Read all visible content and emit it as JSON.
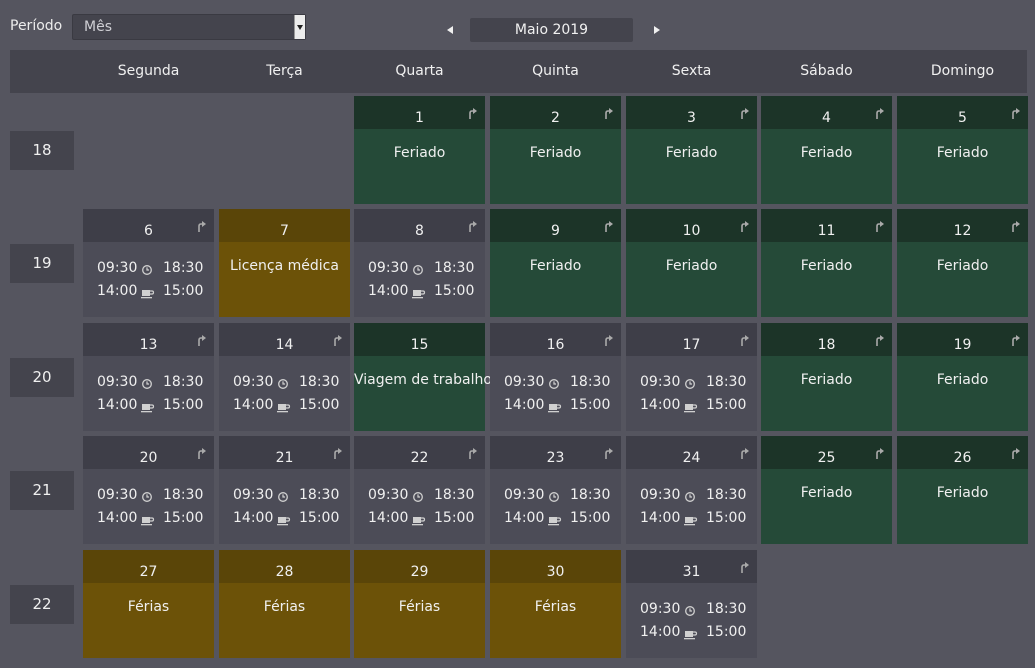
{
  "header": {
    "period_label": "Período",
    "period_value": "Mês",
    "month_title": "Maio 2019"
  },
  "weekdays": [
    "Segunda",
    "Terça",
    "Quarta",
    "Quinta",
    "Sexta",
    "Sábado",
    "Domingo"
  ],
  "weeks": [
    {
      "label": "18",
      "days": [
        null,
        null,
        {
          "day": "1",
          "type": "hol",
          "label": "Feriado",
          "arrow": true
        },
        {
          "day": "2",
          "type": "hol",
          "label": "Feriado",
          "arrow": true
        },
        {
          "day": "3",
          "type": "hol",
          "label": "Feriado",
          "arrow": true
        },
        {
          "day": "4",
          "type": "hol",
          "label": "Feriado",
          "arrow": true
        },
        {
          "day": "5",
          "type": "hol",
          "label": "Feriado",
          "arrow": true
        }
      ]
    },
    {
      "label": "19",
      "days": [
        {
          "day": "6",
          "type": "work",
          "arrow": true,
          "start": "09:30",
          "end": "18:30",
          "break_start": "14:00",
          "break_end": "15:00"
        },
        {
          "day": "7",
          "type": "leave",
          "label": "Licença médica",
          "arrow": false
        },
        {
          "day": "8",
          "type": "work",
          "arrow": true,
          "start": "09:30",
          "end": "18:30",
          "break_start": "14:00",
          "break_end": "15:00"
        },
        {
          "day": "9",
          "type": "hol",
          "label": "Feriado",
          "arrow": true
        },
        {
          "day": "10",
          "type": "hol",
          "label": "Feriado",
          "arrow": true
        },
        {
          "day": "11",
          "type": "hol",
          "label": "Feriado",
          "arrow": true
        },
        {
          "day": "12",
          "type": "hol",
          "label": "Feriado",
          "arrow": true
        }
      ]
    },
    {
      "label": "20",
      "days": [
        {
          "day": "13",
          "type": "work",
          "arrow": true,
          "start": "09:30",
          "end": "18:30",
          "break_start": "14:00",
          "break_end": "15:00"
        },
        {
          "day": "14",
          "type": "work",
          "arrow": true,
          "start": "09:30",
          "end": "18:30",
          "break_start": "14:00",
          "break_end": "15:00"
        },
        {
          "day": "15",
          "type": "trip",
          "label": "Viagem de trabalho",
          "arrow": false
        },
        {
          "day": "16",
          "type": "work",
          "arrow": true,
          "start": "09:30",
          "end": "18:30",
          "break_start": "14:00",
          "break_end": "15:00"
        },
        {
          "day": "17",
          "type": "work",
          "arrow": true,
          "start": "09:30",
          "end": "18:30",
          "break_start": "14:00",
          "break_end": "15:00"
        },
        {
          "day": "18",
          "type": "hol",
          "label": "Feriado",
          "arrow": true
        },
        {
          "day": "19",
          "type": "hol",
          "label": "Feriado",
          "arrow": true
        }
      ]
    },
    {
      "label": "21",
      "days": [
        {
          "day": "20",
          "type": "work",
          "arrow": true,
          "start": "09:30",
          "end": "18:30",
          "break_start": "14:00",
          "break_end": "15:00"
        },
        {
          "day": "21",
          "type": "work",
          "arrow": true,
          "start": "09:30",
          "end": "18:30",
          "break_start": "14:00",
          "break_end": "15:00"
        },
        {
          "day": "22",
          "type": "work",
          "arrow": true,
          "start": "09:30",
          "end": "18:30",
          "break_start": "14:00",
          "break_end": "15:00"
        },
        {
          "day": "23",
          "type": "work",
          "arrow": true,
          "start": "09:30",
          "end": "18:30",
          "break_start": "14:00",
          "break_end": "15:00"
        },
        {
          "day": "24",
          "type": "work",
          "arrow": true,
          "start": "09:30",
          "end": "18:30",
          "break_start": "14:00",
          "break_end": "15:00"
        },
        {
          "day": "25",
          "type": "hol",
          "label": "Feriado",
          "arrow": true
        },
        {
          "day": "26",
          "type": "hol",
          "label": "Feriado",
          "arrow": true
        }
      ]
    },
    {
      "label": "22",
      "days": [
        {
          "day": "27",
          "type": "leave",
          "label": "Férias",
          "arrow": false
        },
        {
          "day": "28",
          "type": "leave",
          "label": "Férias",
          "arrow": false
        },
        {
          "day": "29",
          "type": "leave",
          "label": "Férias",
          "arrow": false
        },
        {
          "day": "30",
          "type": "leave",
          "label": "Férias",
          "arrow": false
        },
        {
          "day": "31",
          "type": "work",
          "arrow": true,
          "start": "09:30",
          "end": "18:30",
          "break_start": "14:00",
          "break_end": "15:00"
        },
        null,
        null
      ]
    }
  ],
  "colors": {
    "background": "#55555f",
    "workday": "#4c4c57",
    "holiday": "#254a38",
    "leave": "#6c5208"
  },
  "icons": {
    "arrow": "corner-up-arrow-icon",
    "clock": "clock-icon",
    "break": "coffee-cup-icon"
  }
}
